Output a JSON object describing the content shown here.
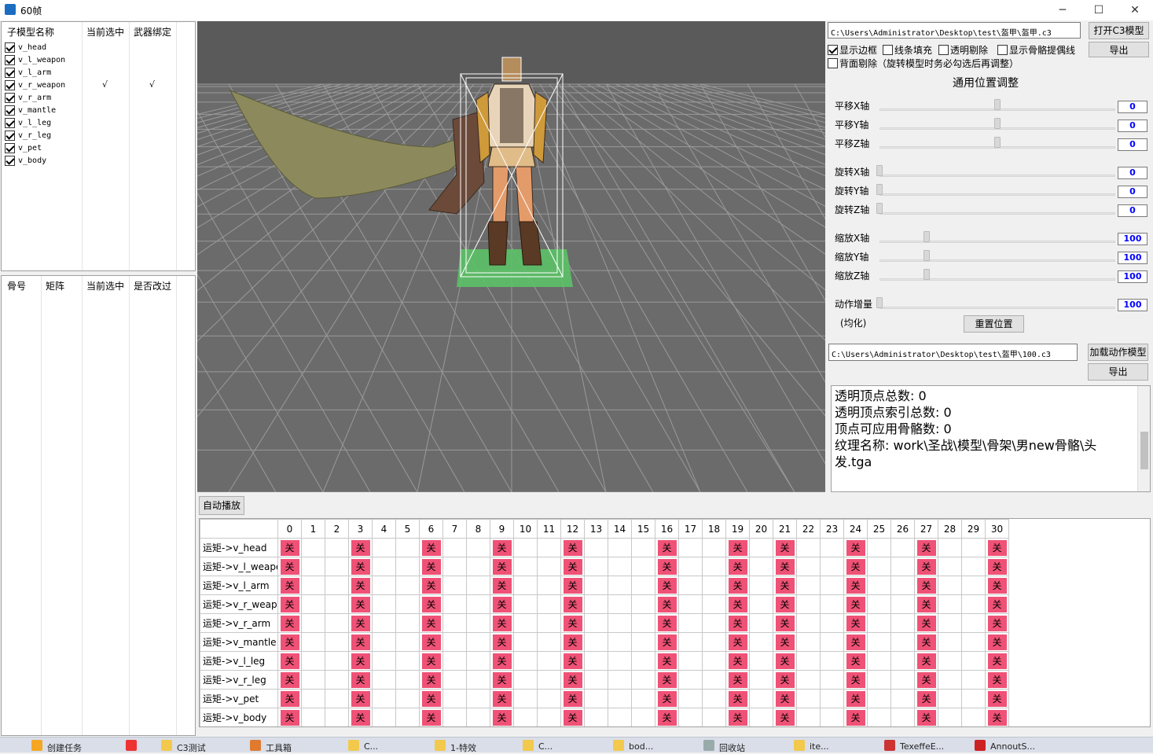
{
  "window": {
    "title": "60帧",
    "min_glyph": "─",
    "max_glyph": "☐",
    "close_glyph": "✕"
  },
  "submodel_table": {
    "headers": [
      "子模型名称",
      "当前选中",
      "武器绑定"
    ],
    "rows": [
      {
        "name": "v_head",
        "checked": true,
        "selected": "",
        "bound": ""
      },
      {
        "name": "v_l_weapon",
        "checked": true,
        "selected": "",
        "bound": ""
      },
      {
        "name": "v_l_arm",
        "checked": true,
        "selected": "",
        "bound": ""
      },
      {
        "name": "v_r_weapon",
        "checked": true,
        "selected": "√",
        "bound": "√"
      },
      {
        "name": "v_r_arm",
        "checked": true,
        "selected": "",
        "bound": ""
      },
      {
        "name": "v_mantle",
        "checked": true,
        "selected": "",
        "bound": ""
      },
      {
        "name": "v_l_leg",
        "checked": true,
        "selected": "",
        "bound": ""
      },
      {
        "name": "v_r_leg",
        "checked": true,
        "selected": "",
        "bound": ""
      },
      {
        "name": "v_pet",
        "checked": true,
        "selected": "",
        "bound": ""
      },
      {
        "name": "v_body",
        "checked": true,
        "selected": "",
        "bound": ""
      }
    ]
  },
  "bone_table": {
    "headers": [
      "骨号",
      "矩阵",
      "当前选中",
      "是否改过"
    ]
  },
  "model_path": "C:\\Users\\Administrator\\Desktop\\test\\盔甲\\盔甲.c3",
  "open_c3_button": "打开C3模型",
  "export_button_1": "导出",
  "options": {
    "show_border": {
      "label": "显示边框",
      "checked": true
    },
    "line_fill": {
      "label": "线条填充",
      "checked": false
    },
    "transparent_cull": {
      "label": "透明剔除",
      "checked": false
    },
    "show_bone_hint": {
      "label": "显示骨骼提偶线",
      "checked": false
    },
    "backface_cull": {
      "label": "背面剔除（旋转模型时务必勾选后再调整）",
      "checked": false
    }
  },
  "position_section_title": "通用位置调整",
  "sliders": [
    {
      "label": "平移X轴",
      "value": "0",
      "level": 0.5
    },
    {
      "label": "平移Y轴",
      "value": "0",
      "level": 0.5
    },
    {
      "label": "平移Z轴",
      "value": "0",
      "level": 0.5
    },
    {
      "label": "旋转X轴",
      "value": "0",
      "level": 0.0
    },
    {
      "label": "旋转Y轴",
      "value": "0",
      "level": 0.0
    },
    {
      "label": "旋转Z轴",
      "value": "0",
      "level": 0.0
    },
    {
      "label": "缩放X轴",
      "value": "100",
      "level": 0.2
    },
    {
      "label": "缩放Y轴",
      "value": "100",
      "level": 0.2
    },
    {
      "label": "缩放Z轴",
      "value": "100",
      "level": 0.2
    },
    {
      "label": "动作增量",
      "value": "100",
      "level": 0.0
    }
  ],
  "equalize_label": "(均化)",
  "reset_button": "重置位置",
  "motion_path": "C:\\Users\\Administrator\\Desktop\\test\\盔甲\\100.c3",
  "load_motion_button": "加载动作模型",
  "export_button_2": "导出",
  "info_lines": [
    "透明顶点总数:  0",
    "透明顶点索引总数:  0",
    "顶点可应用骨骼数:  0",
    "纹理名称:  work\\圣战\\模型\\骨架\\男new骨骼\\头发.tga"
  ],
  "autoplay_button": "自动播放",
  "frame_grid": {
    "frames": [
      "0",
      "1",
      "2",
      "3",
      "4",
      "5",
      "6",
      "7",
      "8",
      "9",
      "10",
      "11",
      "12",
      "13",
      "14",
      "15",
      "16",
      "17",
      "18",
      "19",
      "20",
      "21",
      "22",
      "23",
      "24",
      "25",
      "26",
      "27",
      "28",
      "29",
      "30"
    ],
    "rows": [
      "运矩->v_head",
      "运矩->v_l_weapon",
      "运矩->v_l_arm",
      "运矩->v_r_weapon",
      "运矩->v_r_arm",
      "运矩->v_mantle",
      "运矩->v_l_leg",
      "运矩->v_r_leg",
      "运矩->v_pet",
      "运矩->v_body"
    ],
    "key_frames": [
      0,
      3,
      6,
      9,
      12,
      16,
      19,
      21,
      24,
      27,
      30
    ],
    "key_label": "关",
    "key_color": "#ef5276"
  },
  "taskbar": [
    {
      "label": "创建任务",
      "color": "#f5a623"
    },
    {
      "label": "",
      "color": "#e33"
    },
    {
      "label": "C3测试",
      "color": "#f2c94c"
    },
    {
      "label": "工具箱",
      "color": "#e07a2f"
    },
    {
      "label": "C...",
      "color": "#f2c94c"
    },
    {
      "label": "1-特效",
      "color": "#f2c94c"
    },
    {
      "label": "C...",
      "color": "#f2c94c"
    },
    {
      "label": "bod...",
      "color": "#f2c94c"
    },
    {
      "label": "回收站",
      "color": "#9aa"
    },
    {
      "label": "ite...",
      "color": "#f2c94c"
    },
    {
      "label": "TexeffeE...",
      "color": "#c33"
    },
    {
      "label": "AnnoutS...",
      "color": "#c22"
    }
  ]
}
